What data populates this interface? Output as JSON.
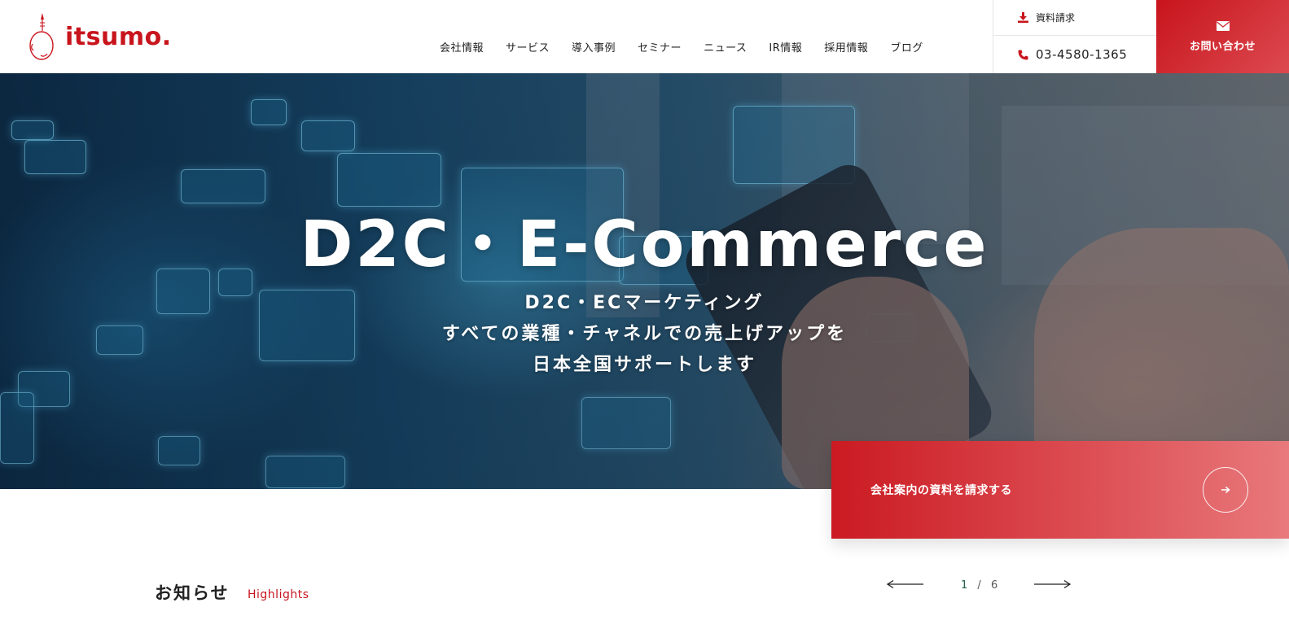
{
  "brand": {
    "name": "itsumo.",
    "color": "#c8151d"
  },
  "nav": {
    "items": [
      {
        "label": "会社情報"
      },
      {
        "label": "サービス"
      },
      {
        "label": "導入事例"
      },
      {
        "label": "セミナー"
      },
      {
        "label": "ニュース"
      },
      {
        "label": "IR情報"
      },
      {
        "label": "採用情報"
      },
      {
        "label": "ブログ"
      }
    ]
  },
  "header_utils": {
    "request_docs_label": "資料請求",
    "request_docs_icon": "download-icon",
    "phone": "03-4580-1365",
    "phone_icon": "phone-icon",
    "contact_label": "お問い合わせ",
    "contact_icon": "envelope-icon"
  },
  "hero": {
    "title": "D2C・E-Commerce",
    "subtitle_lines": [
      "D2C・ECマーケティング",
      "すべての業種・チャネルでの売上げアップを",
      "日本全国サポートします"
    ]
  },
  "cta": {
    "label": "会社案内の資料を請求する",
    "icon": "arrow-right-icon"
  },
  "news": {
    "title": "お知らせ",
    "subtitle": "Highlights",
    "pager": {
      "current": "1",
      "separator": "/",
      "total": "6"
    }
  }
}
